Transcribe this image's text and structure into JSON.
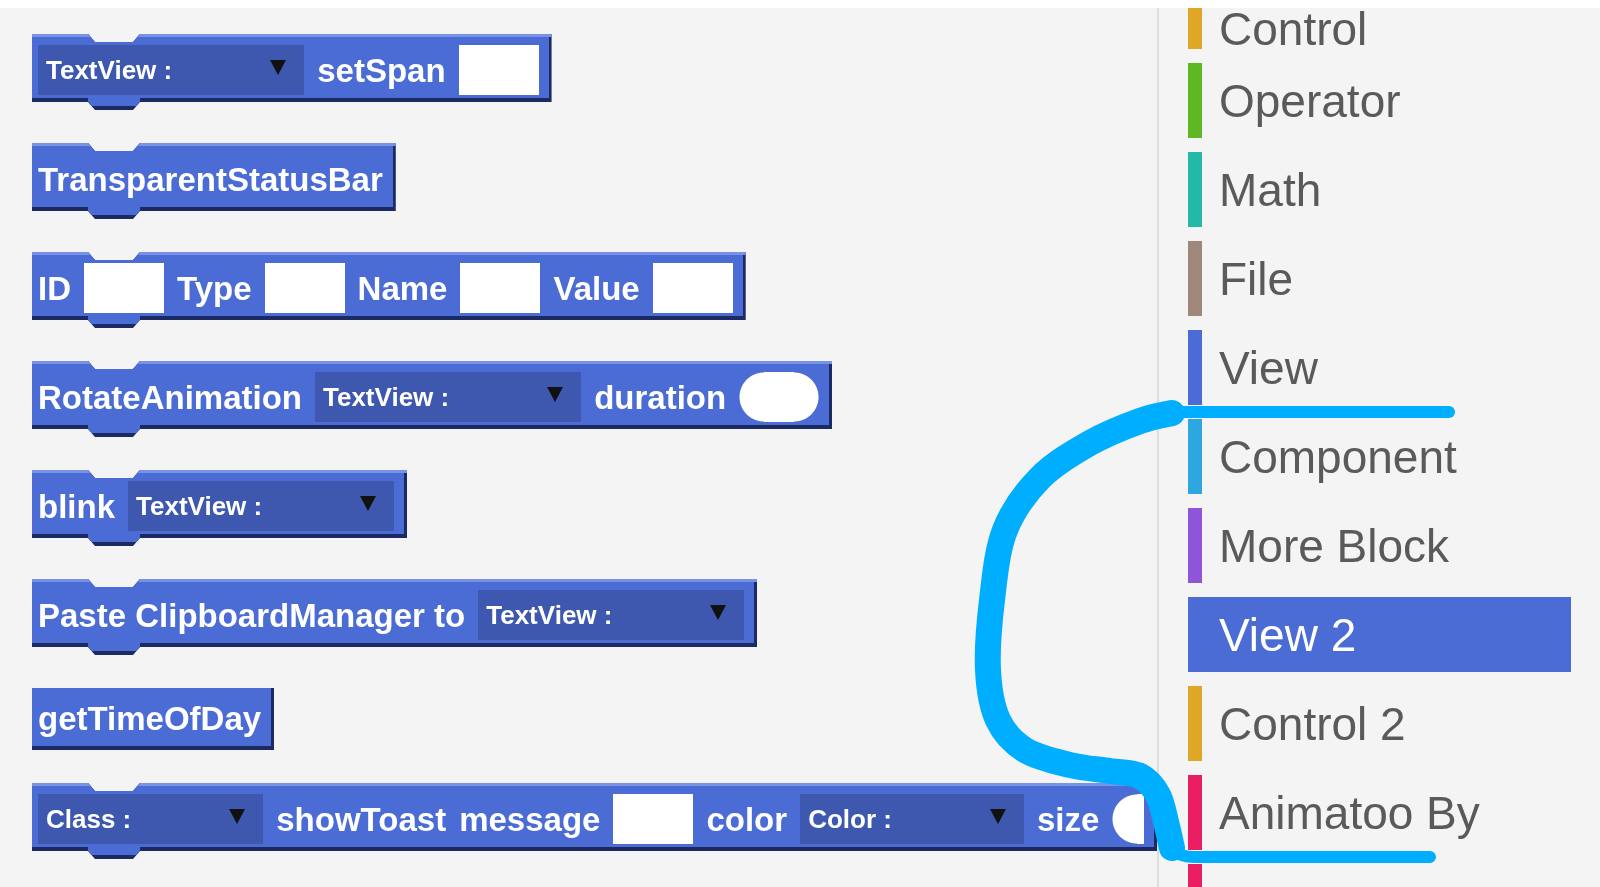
{
  "canvas": {
    "blocks": [
      {
        "kind": "stack",
        "parts": [
          {
            "kind": "dropdown",
            "text": "TextView :"
          },
          {
            "kind": "label",
            "text": "setSpan"
          },
          {
            "kind": "input"
          }
        ]
      },
      {
        "kind": "stack",
        "parts": [
          {
            "kind": "label",
            "text": "TransparentStatusBar"
          }
        ]
      },
      {
        "kind": "stack",
        "parts": [
          {
            "kind": "label",
            "text": "ID"
          },
          {
            "kind": "input"
          },
          {
            "kind": "label",
            "text": "Type"
          },
          {
            "kind": "input"
          },
          {
            "kind": "label",
            "text": "Name"
          },
          {
            "kind": "input"
          },
          {
            "kind": "label",
            "text": "Value"
          },
          {
            "kind": "input"
          }
        ]
      },
      {
        "kind": "stack",
        "parts": [
          {
            "kind": "label",
            "text": "RotateAnimation"
          },
          {
            "kind": "dropdown",
            "text": "TextView :"
          },
          {
            "kind": "label",
            "text": "duration"
          },
          {
            "kind": "number"
          }
        ]
      },
      {
        "kind": "stack",
        "parts": [
          {
            "kind": "label",
            "text": "blink"
          },
          {
            "kind": "dropdown",
            "text": "TextView :"
          }
        ]
      },
      {
        "kind": "stack",
        "parts": [
          {
            "kind": "label",
            "text": "Paste ClipboardManager to"
          },
          {
            "kind": "dropdown",
            "text": "TextView :"
          }
        ]
      },
      {
        "kind": "reporter",
        "parts": [
          {
            "kind": "label",
            "text": "getTimeOfDay"
          }
        ]
      },
      {
        "kind": "stack",
        "parts": [
          {
            "kind": "dropdown",
            "text": "Class :"
          },
          {
            "kind": "label",
            "text": "showToast"
          },
          {
            "kind": "label",
            "text": "message"
          },
          {
            "kind": "input"
          },
          {
            "kind": "label",
            "text": "color"
          },
          {
            "kind": "dropdown",
            "text": "Color :"
          },
          {
            "kind": "label",
            "text": "size"
          },
          {
            "kind": "number"
          }
        ]
      }
    ]
  },
  "palette": {
    "items": [
      {
        "label": "Control",
        "color": "#e0a628",
        "selected": false
      },
      {
        "label": "Operator",
        "color": "#5db824",
        "selected": false
      },
      {
        "label": "Math",
        "color": "#23b9a6",
        "selected": false
      },
      {
        "label": "File",
        "color": "#a0877c",
        "selected": false
      },
      {
        "label": "View",
        "color": "#4a6cd4",
        "selected": false
      },
      {
        "label": "Component",
        "color": "#2ea7e0",
        "selected": false
      },
      {
        "label": "More Block",
        "color": "#8e55d8",
        "selected": false
      },
      {
        "label": "View 2",
        "color": "#4a6cd4",
        "selected": true
      },
      {
        "label": "Control 2",
        "color": "#e0a628",
        "selected": false
      },
      {
        "label": "Animatoo By",
        "color": "#e91e63",
        "selected": false
      },
      {
        "color": "#e91e63",
        "selected": false
      }
    ]
  }
}
